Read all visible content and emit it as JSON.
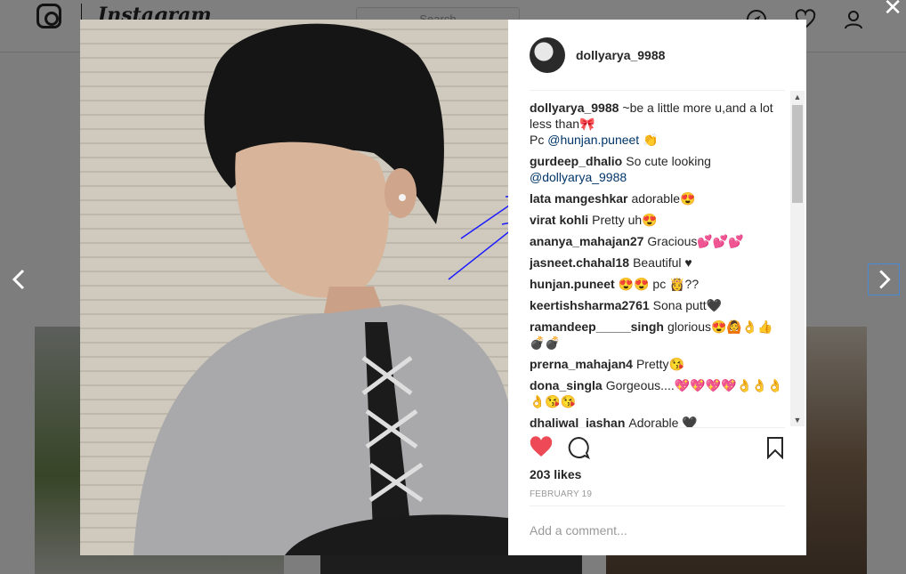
{
  "app": {
    "wordmark": "Instagram",
    "search_placeholder": "Search"
  },
  "post": {
    "author": "dollyarya_9988",
    "caption": {
      "user": "dollyarya_9988",
      "text": "~be a little more u,and a lot less than🎀",
      "line2_prefix": "Pc ",
      "mention": "@hunjan.puneet",
      "line2_suffix": " 👏"
    },
    "comments": [
      {
        "user": "gurdeep_dhalio",
        "text": "So cute looking",
        "mention": "@dollyarya_9988"
      },
      {
        "user": "lata mangeshkar",
        "text": "adorable😍"
      },
      {
        "user": "virat kohli",
        "text": "Pretty uh😍"
      },
      {
        "user": "ananya_mahajan27",
        "text": "Gracious💕💕💕"
      },
      {
        "user": "jasneet.chahal18",
        "text": "Beautiful ♥"
      },
      {
        "user": "hunjan.puneet",
        "text": "😍😍 pc 👸??"
      },
      {
        "user": "keertishsharma2761",
        "text": "Sona putt🖤"
      },
      {
        "user": "ramandeep_____singh",
        "text": "glorious😍🙆👌👍💣💣"
      },
      {
        "user": "prerna_mahajan4",
        "text": "Pretty😘"
      },
      {
        "user": "dona_singla",
        "text": "Gorgeous....💖💖💖💖👌👌👌👌😘😘"
      },
      {
        "user": "dhaliwal_jashan",
        "text": "Adorable 🖤"
      }
    ],
    "likes": "203 likes",
    "date": "FEBRUARY 19",
    "add_comment_placeholder": "Add a comment..."
  },
  "colors": {
    "heart": "#ed4956",
    "mention": "#003569",
    "annotation": "#1a1aff"
  },
  "icons": [
    "instagram-logo-icon",
    "compass-icon",
    "heart-icon",
    "profile-icon",
    "close-icon",
    "chevron-left-icon",
    "chevron-right-icon",
    "like-heart-icon",
    "comment-icon",
    "bookmark-icon"
  ]
}
